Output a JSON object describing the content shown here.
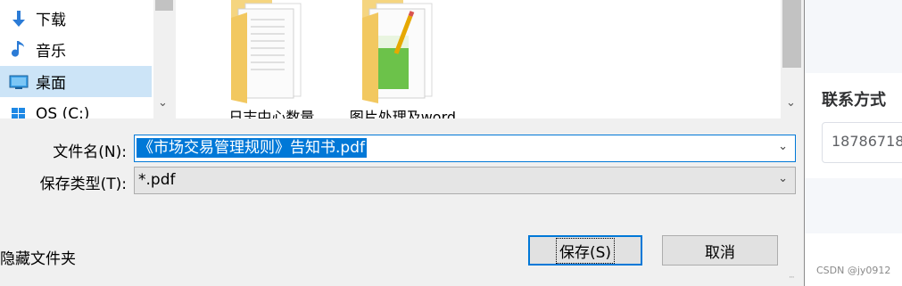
{
  "nav": {
    "items": [
      {
        "label": "下载",
        "icon": "download-arrow-icon"
      },
      {
        "label": "音乐",
        "icon": "music-note-icon"
      },
      {
        "label": "桌面",
        "icon": "desktop-icon",
        "selected": true
      },
      {
        "label": "OS (C:)",
        "icon": "windows-drive-icon"
      }
    ]
  },
  "files": [
    {
      "label": "日志中心数量...",
      "icon": "folder-icon"
    },
    {
      "label": "图片处理及word...",
      "icon": "folder-image-icon"
    }
  ],
  "filename": {
    "label": "文件名(N):",
    "value": "《市场交易管理规则》告知书.pdf"
  },
  "filetype": {
    "label": "保存类型(T):",
    "value": "*.pdf"
  },
  "hide_folders": "隐藏文件夹",
  "buttons": {
    "save": "保存(S)",
    "cancel": "取消"
  },
  "page": {
    "contact_heading": "联系方式",
    "contact_value": "18786718",
    "watermark": "CSDN @jy0912"
  },
  "colors": {
    "accent": "#0078d7",
    "selected_bg": "#cce4f7"
  }
}
